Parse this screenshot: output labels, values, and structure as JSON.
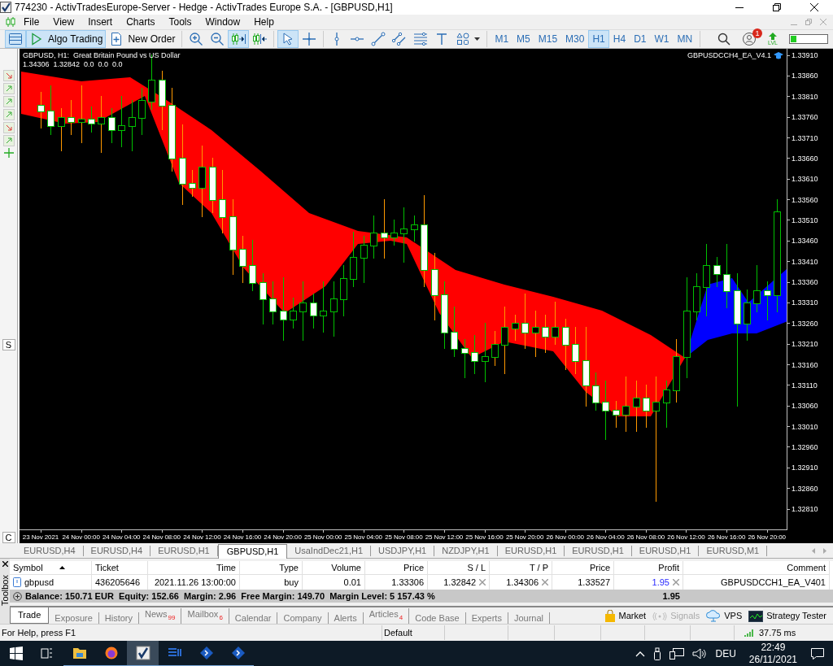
{
  "window": {
    "title": "774230 - ActivTradesEurope-Server - Hedge - ActivTrades Europe S.A. - [GBPUSD,H1]"
  },
  "menu": [
    "File",
    "View",
    "Insert",
    "Charts",
    "Tools",
    "Window",
    "Help"
  ],
  "toolbar": {
    "groups": [
      [
        {
          "kind": "market-watch",
          "on": true
        },
        {
          "kind": "algo-trading",
          "label": "Algo Trading",
          "on": true
        },
        {
          "kind": "new-order",
          "label": "New Order",
          "on": false
        }
      ],
      [
        {
          "kind": "zoom-in",
          "on": false
        },
        {
          "kind": "zoom-out",
          "on": false
        },
        {
          "kind": "autoscroll",
          "on": true
        },
        {
          "kind": "chart-shift",
          "on": false
        }
      ],
      [
        {
          "kind": "cursor",
          "on": true
        },
        {
          "kind": "crosshair",
          "on": false
        }
      ],
      [
        {
          "kind": "vertical-line",
          "on": false
        },
        {
          "kind": "horizontal-line",
          "on": false
        },
        {
          "kind": "trendline",
          "on": false
        },
        {
          "kind": "channel",
          "on": false
        },
        {
          "kind": "fibonacci",
          "on": false
        },
        {
          "kind": "text",
          "on": false
        },
        {
          "kind": "shapes",
          "on": false
        }
      ]
    ],
    "timeframes": [
      {
        "label": "M1",
        "selected": false
      },
      {
        "label": "M5",
        "selected": false
      },
      {
        "label": "M15",
        "selected": false
      },
      {
        "label": "M30",
        "selected": false
      },
      {
        "label": "H1",
        "selected": true
      },
      {
        "label": "H4",
        "selected": false
      },
      {
        "label": "D1",
        "selected": false
      },
      {
        "label": "W1",
        "selected": false
      },
      {
        "label": "MN",
        "selected": false
      }
    ],
    "notification_count": "1",
    "level_label": "LVL",
    "meter": {
      "level": 0.15
    }
  },
  "side_panel": {
    "tabs": [
      "S",
      "C"
    ]
  },
  "chart": {
    "header": "GBPUSD, H1:  Great Britain Pound vs US Dollar",
    "values": "1.34306  1.32842  0.0  0.0  0.0",
    "expert": "GBPUSDCCH4_EA_V4.1",
    "chart_data": {
      "type": "candlestick",
      "categories": [
        "23 Nov 2021",
        null,
        null,
        null,
        "24 Nov 00:00",
        null,
        null,
        null,
        "24 Nov 04:00",
        null,
        null,
        null,
        "24 Nov 08:00",
        null,
        null,
        null,
        "24 Nov 12:00",
        null,
        null,
        null,
        "24 Nov 16:00",
        null,
        null,
        null,
        "24 Nov 20:00",
        null,
        null,
        null,
        "25 Nov 00:00",
        null,
        null,
        null,
        "25 Nov 04:00",
        null,
        null,
        null,
        "25 Nov 08:00",
        null,
        null,
        null,
        "25 Nov 12:00",
        null,
        null,
        null,
        "25 Nov 16:00",
        null,
        null,
        null,
        "25 Nov 20:00",
        null,
        null,
        null,
        "26 Nov 00:00",
        null,
        null,
        null,
        "26 Nov 04:00",
        null,
        null,
        null,
        "26 Nov 08:00",
        null,
        null,
        null,
        "26 Nov 12:00",
        null,
        null,
        null,
        "26 Nov 16:00",
        null,
        null,
        null,
        "26 Nov 20:00",
        null
      ],
      "ohlc": [
        [
          1.3379,
          1.3382,
          1.33735,
          1.33775
        ],
        [
          1.33775,
          1.33835,
          1.3372,
          1.3374
        ],
        [
          1.3374,
          1.3378,
          1.3368,
          1.3376
        ],
        [
          1.3376,
          1.338,
          1.3372,
          1.3375
        ],
        [
          1.3375,
          1.33835,
          1.337,
          1.33755
        ],
        [
          1.33755,
          1.33785,
          1.33725,
          1.33745
        ],
        [
          1.33745,
          1.3381,
          1.33675,
          1.3376
        ],
        [
          1.3376,
          1.3378,
          1.337,
          1.3373
        ],
        [
          1.3373,
          1.3381,
          1.3369,
          1.3374
        ],
        [
          1.3374,
          1.338,
          1.3368,
          1.3376
        ],
        [
          1.3376,
          1.3383,
          1.3372,
          1.338
        ],
        [
          1.338,
          1.3391,
          1.3378,
          1.3385
        ],
        [
          1.3385,
          1.3387,
          1.3373,
          1.3379
        ],
        [
          1.3379,
          1.3383,
          1.3363,
          1.3366
        ],
        [
          1.3366,
          1.3374,
          1.3355,
          1.336
        ],
        [
          1.336,
          1.3363,
          1.3357,
          1.3359
        ],
        [
          1.3359,
          1.3369,
          1.3352,
          1.3364
        ],
        [
          1.3364,
          1.3366,
          1.3353,
          1.3356
        ],
        [
          1.3356,
          1.3363,
          1.3348,
          1.3352
        ],
        [
          1.3352,
          1.3356,
          1.3338,
          1.3344
        ],
        [
          1.3344,
          1.3347,
          1.3336,
          1.334
        ],
        [
          1.334,
          1.3346,
          1.3334,
          1.3336
        ],
        [
          1.3336,
          1.3338,
          1.3326,
          1.3332
        ],
        [
          1.3332,
          1.3336,
          1.3326,
          1.3329
        ],
        [
          1.3329,
          1.3337,
          1.3322,
          1.3327
        ],
        [
          1.3327,
          1.3332,
          1.3325,
          1.3329
        ],
        [
          1.3329,
          1.3336,
          1.3322,
          1.3331
        ],
        [
          1.3331,
          1.3333,
          1.3325,
          1.3328
        ],
        [
          1.3328,
          1.3336,
          1.3324,
          1.3329
        ],
        [
          1.3329,
          1.3336,
          1.3323,
          1.3332
        ],
        [
          1.3332,
          1.334,
          1.3328,
          1.3337
        ],
        [
          1.3337,
          1.3348,
          1.3335,
          1.3342
        ],
        [
          1.3342,
          1.3347,
          1.3336,
          1.3345
        ],
        [
          1.3345,
          1.3352,
          1.3342,
          1.3348
        ],
        [
          1.3348,
          1.3356,
          1.3342,
          1.3347
        ],
        [
          1.3347,
          1.3351,
          1.3345,
          1.3348
        ],
        [
          1.3348,
          1.3354,
          1.3341,
          1.3349
        ],
        [
          1.3349,
          1.3352,
          1.3346,
          1.335
        ],
        [
          1.335,
          1.3357,
          1.3335,
          1.3339
        ],
        [
          1.3339,
          1.3343,
          1.3327,
          1.3333
        ],
        [
          1.3333,
          1.3336,
          1.332,
          1.3324
        ],
        [
          1.3324,
          1.333,
          1.3318,
          1.332
        ],
        [
          1.332,
          1.3322,
          1.3313,
          1.3319
        ],
        [
          1.3319,
          1.3323,
          1.3314,
          1.3317
        ],
        [
          1.3317,
          1.3326,
          1.3312,
          1.3318
        ],
        [
          1.3318,
          1.3324,
          1.3316,
          1.3321
        ],
        [
          1.3321,
          1.333,
          1.3314,
          1.3325
        ],
        [
          1.3325,
          1.3328,
          1.3322,
          1.3326
        ],
        [
          1.3326,
          1.3333,
          1.332,
          1.3324
        ],
        [
          1.3324,
          1.3329,
          1.3318,
          1.3325
        ],
        [
          1.3325,
          1.3328,
          1.3319,
          1.3323
        ],
        [
          1.3323,
          1.3331,
          1.3321,
          1.3325
        ],
        [
          1.3325,
          1.3327,
          1.3315,
          1.3321
        ],
        [
          1.3321,
          1.3325,
          1.3314,
          1.3317
        ],
        [
          1.3317,
          1.3325,
          1.3306,
          1.3311
        ],
        [
          1.3311,
          1.3314,
          1.3305,
          1.3307
        ],
        [
          1.3307,
          1.3312,
          1.3298,
          1.3305
        ],
        [
          1.3305,
          1.3307,
          1.3301,
          1.3304
        ],
        [
          1.3304,
          1.3313,
          1.33,
          1.3306
        ],
        [
          1.3306,
          1.3312,
          1.33,
          1.3308
        ],
        [
          1.3308,
          1.3311,
          1.3301,
          1.3305
        ],
        [
          1.3305,
          1.3313,
          1.3283,
          1.3307
        ],
        [
          1.3307,
          1.3312,
          1.3301,
          1.331
        ],
        [
          1.331,
          1.3322,
          1.3307,
          1.3318
        ],
        [
          1.3318,
          1.3337,
          1.3313,
          1.3329
        ],
        [
          1.3329,
          1.3338,
          1.3327,
          1.3335
        ],
        [
          1.3335,
          1.3345,
          1.3328,
          1.334
        ],
        [
          1.334,
          1.3342,
          1.3335,
          1.3338
        ],
        [
          1.3338,
          1.3345,
          1.333,
          1.3334
        ],
        [
          1.3334,
          1.3338,
          1.3306,
          1.3326
        ],
        [
          1.3326,
          1.3334,
          1.3322,
          1.3331
        ],
        [
          1.3331,
          1.334,
          1.3329,
          1.3334
        ],
        [
          1.3334,
          1.3336,
          1.3327,
          1.3333
        ],
        [
          1.3333,
          1.3356,
          1.3329,
          1.3353
        ]
      ],
      "ylim": [
        1.32761,
        1.33926
      ],
      "yticks": [
        {
          "value": 1.3391,
          "label": "1.33910"
        },
        {
          "value": 1.3386,
          "label": "1.33860"
        },
        {
          "value": 1.3381,
          "label": "1.33810"
        },
        {
          "value": 1.3376,
          "label": "1.33760"
        },
        {
          "value": 1.3371,
          "label": "1.33710"
        },
        {
          "value": 1.3366,
          "label": "1.33660"
        },
        {
          "value": 1.3361,
          "label": "1.33610"
        },
        {
          "value": 1.3356,
          "label": "1.33560"
        },
        {
          "value": 1.3351,
          "label": "1.33510"
        },
        {
          "value": 1.3346,
          "label": "1.33460"
        },
        {
          "value": 1.3341,
          "label": "1.33410"
        },
        {
          "value": 1.3336,
          "label": "1.33360"
        },
        {
          "value": 1.3331,
          "label": "1.33310"
        },
        {
          "value": 1.3326,
          "label": "1.33260"
        },
        {
          "value": 1.3321,
          "label": "1.33210"
        },
        {
          "value": 1.3316,
          "label": "1.33160"
        },
        {
          "value": 1.3311,
          "label": "1.33110"
        },
        {
          "value": 1.3306,
          "label": "1.33060"
        },
        {
          "value": 1.3301,
          "label": "1.33010"
        },
        {
          "value": 1.3296,
          "label": "1.32960"
        },
        {
          "value": 1.3291,
          "label": "1.32910"
        },
        {
          "value": 1.3286,
          "label": "1.32860"
        },
        {
          "value": 1.3281,
          "label": "1.32810"
        }
      ]
    }
  },
  "chart_tabs": [
    {
      "label": "EURUSD,H4",
      "selected": false
    },
    {
      "label": "EURUSD,H4",
      "selected": false
    },
    {
      "label": "EURUSD,H1",
      "selected": false
    },
    {
      "label": "GBPUSD,H1",
      "selected": true
    },
    {
      "label": "UsaIndDec21,H1",
      "selected": false
    },
    {
      "label": "USDJPY,H1",
      "selected": false
    },
    {
      "label": "NZDJPY,H1",
      "selected": false
    },
    {
      "label": "EURUSD,H1",
      "selected": false
    },
    {
      "label": "EURUSD,H1",
      "selected": false
    },
    {
      "label": "EURUSD,H1",
      "selected": false
    },
    {
      "label": "EURUSD,M1",
      "selected": false
    }
  ],
  "toolbox": {
    "title": "Toolbox",
    "columns": [
      {
        "label": "Symbol",
        "kind": "symbol",
        "sorted": true
      },
      {
        "label": "Ticket",
        "kind": "text",
        "sorted": false
      },
      {
        "label": "Time",
        "kind": "number",
        "sorted": false
      },
      {
        "label": "Type",
        "kind": "number",
        "sorted": false
      },
      {
        "label": "Volume",
        "kind": "number",
        "sorted": false
      },
      {
        "label": "Price",
        "kind": "number",
        "sorted": false
      },
      {
        "label": "S / L",
        "kind": "stop",
        "sorted": false
      },
      {
        "label": "T / P",
        "kind": "stop",
        "sorted": false
      },
      {
        "label": "Price",
        "kind": "number",
        "sorted": false
      },
      {
        "label": "Profit",
        "kind": "profit",
        "sorted": false
      },
      {
        "label": "Comment",
        "kind": "number",
        "sorted": false
      }
    ],
    "rows": [
      [
        "gbpusd",
        "436205646",
        "2021.11.26 13:00:00",
        "buy",
        "0.01",
        "1.33306",
        "1.32842",
        "1.34306",
        "1.33527",
        "1.95",
        "GBPUSDCCH1_EA_V401"
      ]
    ],
    "summary": "Balance: 150.71 EUR  Equity: 152.66  Margin: 2.96  Free Margin: 149.70  Margin Level: 5 157.43 %",
    "summary_profit": "1.95",
    "tabs": [
      {
        "label": "Trade",
        "selected": true
      },
      {
        "label": "Exposure",
        "selected": false
      },
      {
        "label": "History",
        "selected": false
      },
      {
        "label": "News",
        "badge": "99",
        "selected": false
      },
      {
        "label": "Mailbox",
        "badge": "6",
        "selected": false
      },
      {
        "label": "Calendar",
        "selected": false
      },
      {
        "label": "Company",
        "selected": false
      },
      {
        "label": "Alerts",
        "selected": false
      },
      {
        "label": "Articles",
        "badge": "4",
        "selected": false
      },
      {
        "label": "Code Base",
        "selected": false
      },
      {
        "label": "Experts",
        "selected": false
      },
      {
        "label": "Journal",
        "selected": false
      }
    ],
    "services": [
      {
        "kind": "market",
        "label": "Market",
        "disabled": false
      },
      {
        "kind": "signals",
        "label": "Signals",
        "disabled": true
      },
      {
        "kind": "vps",
        "label": "VPS",
        "disabled": false
      },
      {
        "kind": "tester",
        "label": "Strategy Tester",
        "disabled": false
      }
    ]
  },
  "status_bar": {
    "help": "For Help, press F1",
    "profile": "Default",
    "ping": "37.75 ms"
  },
  "taskbar": {
    "language": "DEU",
    "time": "22:49",
    "date": "26/11/2021"
  }
}
